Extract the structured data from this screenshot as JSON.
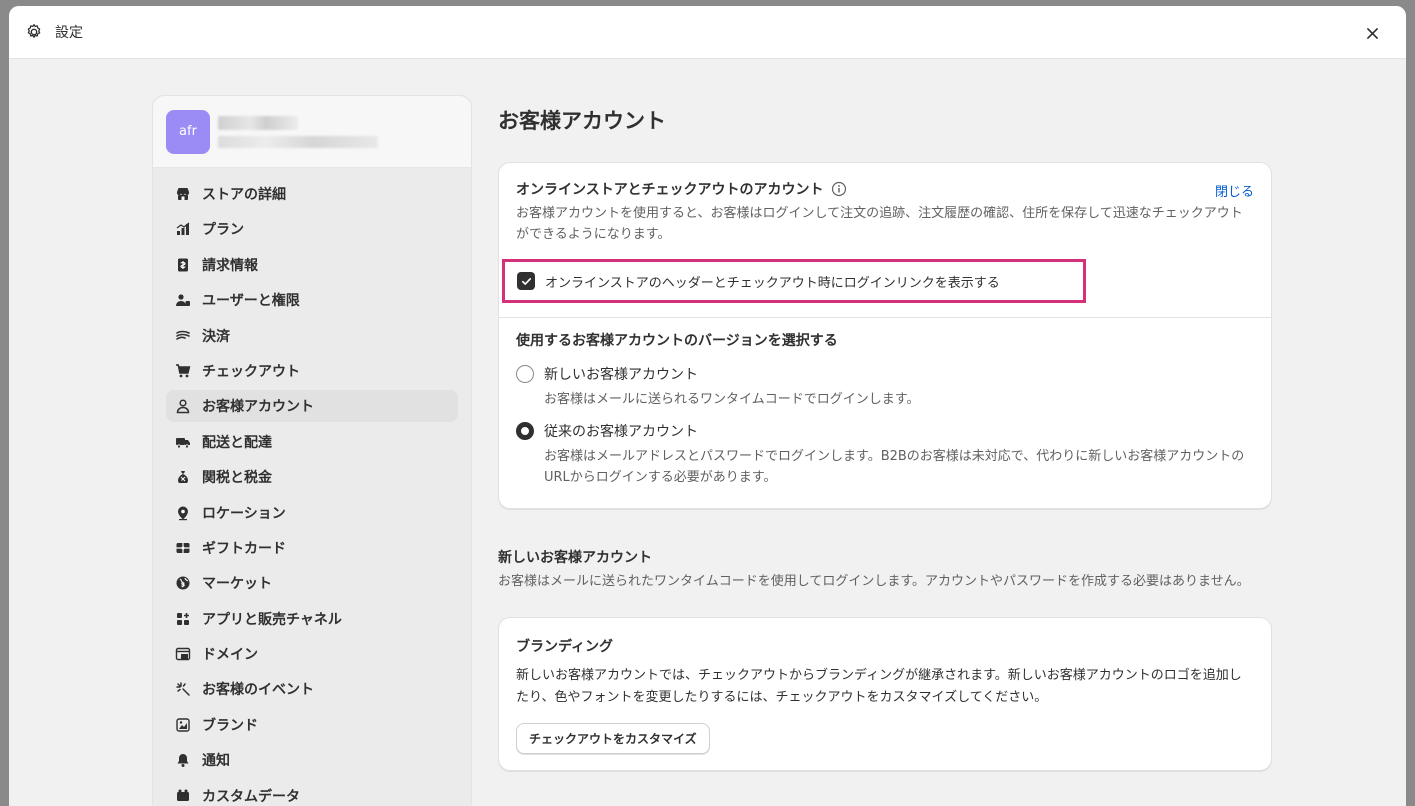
{
  "window": {
    "title": "設定",
    "close_label": "×"
  },
  "store": {
    "avatar_text": "afr"
  },
  "sidebar": {
    "items": [
      {
        "label": "ストアの詳細",
        "icon": "store-icon"
      },
      {
        "label": "プラン",
        "icon": "plan-icon"
      },
      {
        "label": "請求情報",
        "icon": "billing-icon"
      },
      {
        "label": "ユーザーと権限",
        "icon": "users-icon"
      },
      {
        "label": "決済",
        "icon": "payments-icon"
      },
      {
        "label": "チェックアウト",
        "icon": "cart-icon"
      },
      {
        "label": "お客様アカウント",
        "icon": "person-icon",
        "active": true
      },
      {
        "label": "配送と配達",
        "icon": "truck-icon"
      },
      {
        "label": "関税と税金",
        "icon": "tax-icon"
      },
      {
        "label": "ロケーション",
        "icon": "location-icon"
      },
      {
        "label": "ギフトカード",
        "icon": "gift-card-icon"
      },
      {
        "label": "マーケット",
        "icon": "globe-icon"
      },
      {
        "label": "アプリと販売チャネル",
        "icon": "apps-icon"
      },
      {
        "label": "ドメイン",
        "icon": "domain-icon"
      },
      {
        "label": "お客様のイベント",
        "icon": "events-icon"
      },
      {
        "label": "ブランド",
        "icon": "brand-icon"
      },
      {
        "label": "通知",
        "icon": "bell-icon"
      },
      {
        "label": "カスタムデータ",
        "icon": "custom-data-icon"
      }
    ]
  },
  "main": {
    "page_title": "お客様アカウント",
    "accounts_card": {
      "title": "オンラインストアとチェックアウトのアカウント",
      "close_link": "閉じる",
      "description": "お客様アカウントを使用すると、お客様はログインして注文の追跡、注文履歴の確認、住所を保存して迅速なチェックアウトができるようになります。",
      "checkbox_label": "オンラインストアのヘッダーとチェックアウト時にログインリンクを表示する",
      "checkbox_checked": true,
      "version_title": "使用するお客様アカウントのバージョンを選択する",
      "options": [
        {
          "label": "新しいお客様アカウント",
          "help": "お客様はメールに送られるワンタイムコードでログインします。",
          "checked": false
        },
        {
          "label": "従来のお客様アカウント",
          "help": "お客様はメールアドレスとパスワードでログインします。B2Bのお客様は未対応で、代わりに新しいお客様アカウントのURLからログインする必要があります。",
          "checked": true
        }
      ]
    },
    "new_accounts": {
      "title": "新しいお客様アカウント",
      "description": "お客様はメールに送られたワンタイムコードを使用してログインします。アカウントやパスワードを作成する必要はありません。"
    },
    "branding_card": {
      "title": "ブランディング",
      "description": "新しいお客様アカウントでは、チェックアウトからブランディングが継承されます。新しいお客様アカウントのロゴを追加したり、色やフォントを変更したりするには、チェックアウトをカスタマイズしてください。",
      "button_label": "チェックアウトをカスタマイズ"
    }
  },
  "colors": {
    "highlight": "#d4317a",
    "link": "#005bd3",
    "avatar": "#9b8cf5"
  }
}
